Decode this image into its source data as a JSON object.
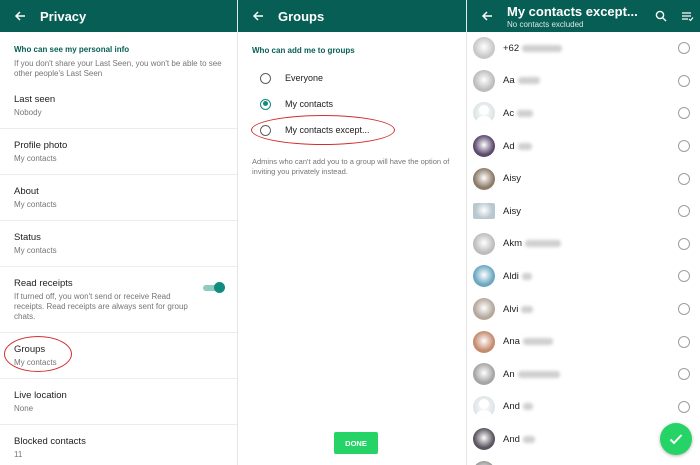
{
  "privacy": {
    "title": "Privacy",
    "section_heading": "Who can see my personal info",
    "section_desc": "If you don't share your Last Seen, you won't be able to see other people's Last Seen",
    "items": [
      {
        "label": "Last seen",
        "value": "Nobody"
      },
      {
        "label": "Profile photo",
        "value": "My contacts"
      },
      {
        "label": "About",
        "value": "My contacts"
      },
      {
        "label": "Status",
        "value": "My contacts"
      }
    ],
    "read_receipts": {
      "label": "Read receipts",
      "desc": "If turned off, you won't send or receive Read receipts. Read receipts are always sent for group chats.",
      "enabled": true
    },
    "items2": [
      {
        "label": "Groups",
        "value": "My contacts"
      },
      {
        "label": "Live location",
        "value": "None"
      },
      {
        "label": "Blocked contacts",
        "value": "11"
      }
    ]
  },
  "groups": {
    "title": "Groups",
    "heading": "Who can add me to groups",
    "options": [
      {
        "label": "Everyone",
        "checked": false
      },
      {
        "label": "My contacts",
        "checked": true
      },
      {
        "label": "My contacts except...",
        "checked": false
      }
    ],
    "note": "Admins who can't add you to a group will have the option of inviting you privately instead.",
    "done_label": "DONE"
  },
  "except": {
    "title": "My contacts except...",
    "subtitle": "No contacts excluded",
    "icons": [
      "search-icon",
      "select-all-icon"
    ],
    "contacts": [
      {
        "name": "+62",
        "avatar": "#c9c9c9"
      },
      {
        "name": "Aa",
        "avatar": "#bdbdbd"
      },
      {
        "name": "Ac",
        "avatar": "#dfe5e7"
      },
      {
        "name": "Ad",
        "avatar": "#5b4a6e"
      },
      {
        "name": "Aisy",
        "avatar": "#8d7b6a"
      },
      {
        "name": "Aisy",
        "avatar": "#b9c7cf"
      },
      {
        "name": "Akm",
        "avatar": "#bdbdbd"
      },
      {
        "name": "Aldi",
        "avatar": "#6aa7c0"
      },
      {
        "name": "Alvi",
        "avatar": "#b4a89c"
      },
      {
        "name": "Ana",
        "avatar": "#c58a6e"
      },
      {
        "name": "An",
        "avatar": "#a5a5a5"
      },
      {
        "name": "And",
        "avatar": "#dfe5e7"
      },
      {
        "name": "And",
        "avatar": "#5a5560"
      },
      {
        "name": "",
        "avatar": "#9a9a9a"
      }
    ],
    "accent": "#25d366"
  },
  "colors": {
    "appbar": "#075e54",
    "accent": "#128c7e",
    "button": "#25d366",
    "annotation": "#d32f2f"
  }
}
